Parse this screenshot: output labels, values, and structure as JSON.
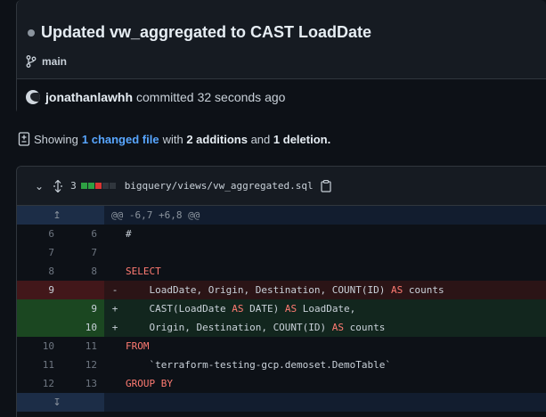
{
  "commit": {
    "title": "Updated vw_aggregated to CAST LoadDate",
    "branch": "main",
    "author": "jonathanlawhh",
    "action": "committed",
    "time": "32 seconds ago"
  },
  "summary": {
    "prefix": "Showing",
    "changed_files": "1 changed file",
    "with": "with",
    "additions": "2 additions",
    "and": "and",
    "deletions": "1 deletion."
  },
  "file": {
    "change_count": "3",
    "path": "bigquery/views/vw_aggregated.sql",
    "diffstat": [
      "#2ea043",
      "#2ea043",
      "#da3633",
      "#30363d",
      "#30363d"
    ],
    "hunk_header": "@@ -6,7 +6,8 @@",
    "lines": [
      {
        "type": "ctx",
        "old": "6",
        "new": "6",
        "sign": "",
        "code": "#"
      },
      {
        "type": "ctx",
        "old": "7",
        "new": "7",
        "sign": "",
        "code": ""
      },
      {
        "type": "ctx",
        "old": "8",
        "new": "8",
        "sign": "",
        "code": "SELECT"
      },
      {
        "type": "del",
        "old": "9",
        "new": "",
        "sign": "-",
        "code": "    LoadDate, Origin, Destination, COUNT(ID) AS counts"
      },
      {
        "type": "add",
        "old": "",
        "new": "9",
        "sign": "+",
        "code": "    CAST(LoadDate AS DATE) AS LoadDate,"
      },
      {
        "type": "add",
        "old": "",
        "new": "10",
        "sign": "+",
        "code": "    Origin, Destination, COUNT(ID) AS counts"
      },
      {
        "type": "ctx",
        "old": "10",
        "new": "11",
        "sign": "",
        "code": "FROM"
      },
      {
        "type": "ctx",
        "old": "11",
        "new": "12",
        "sign": "",
        "code": "    `terraform-testing-gcp.demoset.DemoTable`"
      },
      {
        "type": "ctx",
        "old": "12",
        "new": "13",
        "sign": "",
        "code": "GROUP BY"
      }
    ]
  }
}
